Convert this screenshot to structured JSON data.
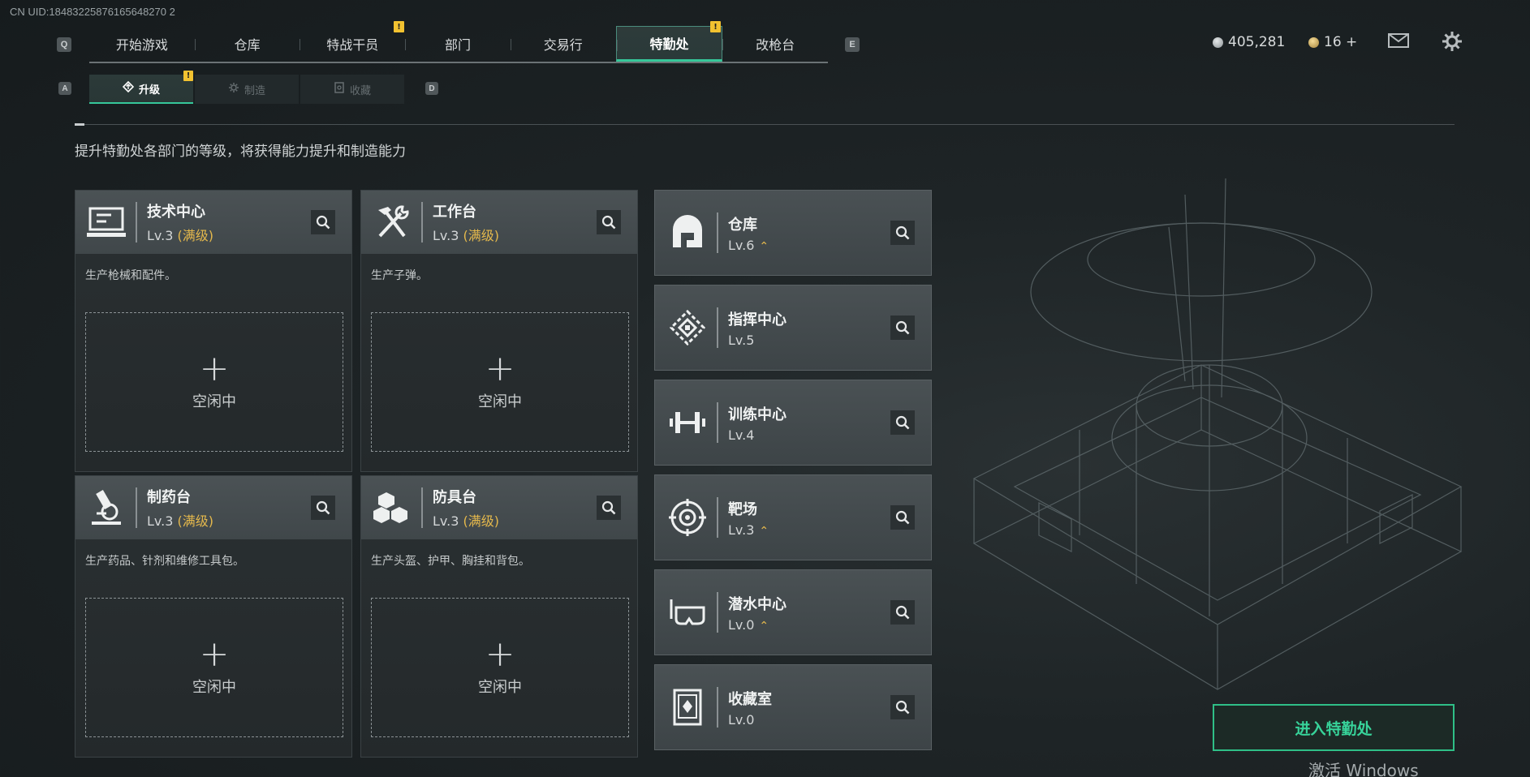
{
  "uid": "CN UID:18483225876165648270 2",
  "nav": {
    "key_left": "Q",
    "key_right": "E",
    "tabs": [
      "开始游戏",
      "仓库",
      "特战干员",
      "部门",
      "交易行",
      "特勤处",
      "改枪台"
    ],
    "badge": "!"
  },
  "currency": {
    "silver": "405,281",
    "gold": "16 +"
  },
  "subnav": {
    "key_left": "A",
    "key_right": "D",
    "tabs": [
      "升级",
      "制造",
      "收藏"
    ],
    "badge": "!"
  },
  "subtitle": "提升特勤处各部门的等级，将获得能力提升和制造能力",
  "craft": [
    {
      "name": "技术中心",
      "level": "Lv.3",
      "max": "(满级)",
      "desc": "生产枪械和配件。",
      "plus": "+",
      "idle": "空闲中"
    },
    {
      "name": "工作台",
      "level": "Lv.3",
      "max": "(满级)",
      "desc": "生产子弹。",
      "plus": "+",
      "idle": "空闲中"
    },
    {
      "name": "制药台",
      "level": "Lv.3",
      "max": "(满级)",
      "desc": "生产药品、针剂和维修工具包。",
      "plus": "+",
      "idle": "空闲中"
    },
    {
      "name": "防具台",
      "level": "Lv.3",
      "max": "(满级)",
      "desc": "生产头盔、护甲、胸挂和背包。",
      "plus": "+",
      "idle": "空闲中"
    }
  ],
  "buildings": [
    {
      "name": "仓库",
      "level": "Lv.6",
      "upgradable": true
    },
    {
      "name": "指挥中心",
      "level": "Lv.5",
      "upgradable": false
    },
    {
      "name": "训练中心",
      "level": "Lv.4",
      "upgradable": false
    },
    {
      "name": "靶场",
      "level": "Lv.3",
      "upgradable": true
    },
    {
      "name": "潜水中心",
      "level": "Lv.0",
      "upgradable": true
    },
    {
      "name": "收藏室",
      "level": "Lv.0",
      "upgradable": false
    }
  ],
  "up_glyph": "⌃",
  "enter_button": "进入特勤处",
  "watermark": "激活 Windows",
  "accent_color": "#36c79a",
  "max_color": "#e4b84c"
}
